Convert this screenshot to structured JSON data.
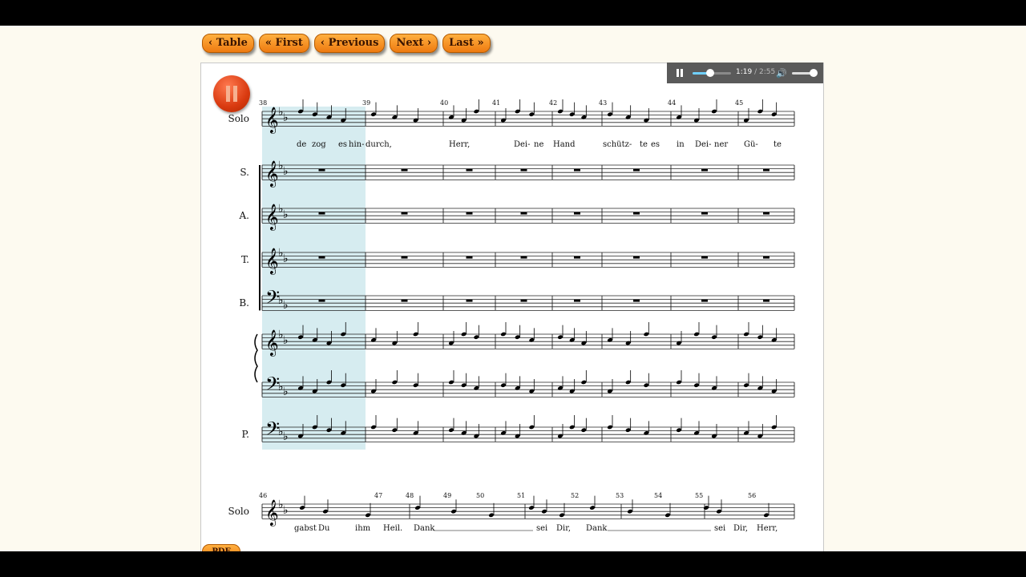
{
  "nav": {
    "table": "‹ Table",
    "first": "« First",
    "previous": "‹ Previous",
    "next": "Next ›",
    "last": "Last »"
  },
  "player": {
    "current": "1:19",
    "duration": " / 2:55",
    "progress": 0.45,
    "volume": 0.9,
    "pause_icon": "pause-icon",
    "volume_icon": "volume-icon"
  },
  "pdf": {
    "label": "PDF"
  },
  "score": {
    "system1": {
      "staves": [
        "Solo",
        "S.",
        "A.",
        "T.",
        "B.",
        "",
        "",
        "P."
      ],
      "bars": [
        "38",
        "39",
        "40",
        "41",
        "42",
        "43",
        "44",
        "45"
      ],
      "lyrics": [
        "de",
        "zog",
        "es",
        "hin-",
        "durch,",
        "Herr,",
        "Dei-",
        "ne",
        "Hand",
        "schütz-",
        "te",
        "es",
        "in",
        "Dei-",
        "ner",
        "Gü-",
        "te"
      ]
    },
    "system2": {
      "staves": [
        "Solo"
      ],
      "bars": [
        "46",
        "47",
        "48",
        "49",
        "50",
        "51",
        "52",
        "53",
        "54",
        "55",
        "56"
      ],
      "lyrics": [
        "gabst",
        "Du",
        "ihm",
        "Heil.",
        "Dank",
        "sei",
        "Dir,",
        "Dank",
        "sei",
        "Dir,",
        "Herr,"
      ]
    }
  }
}
